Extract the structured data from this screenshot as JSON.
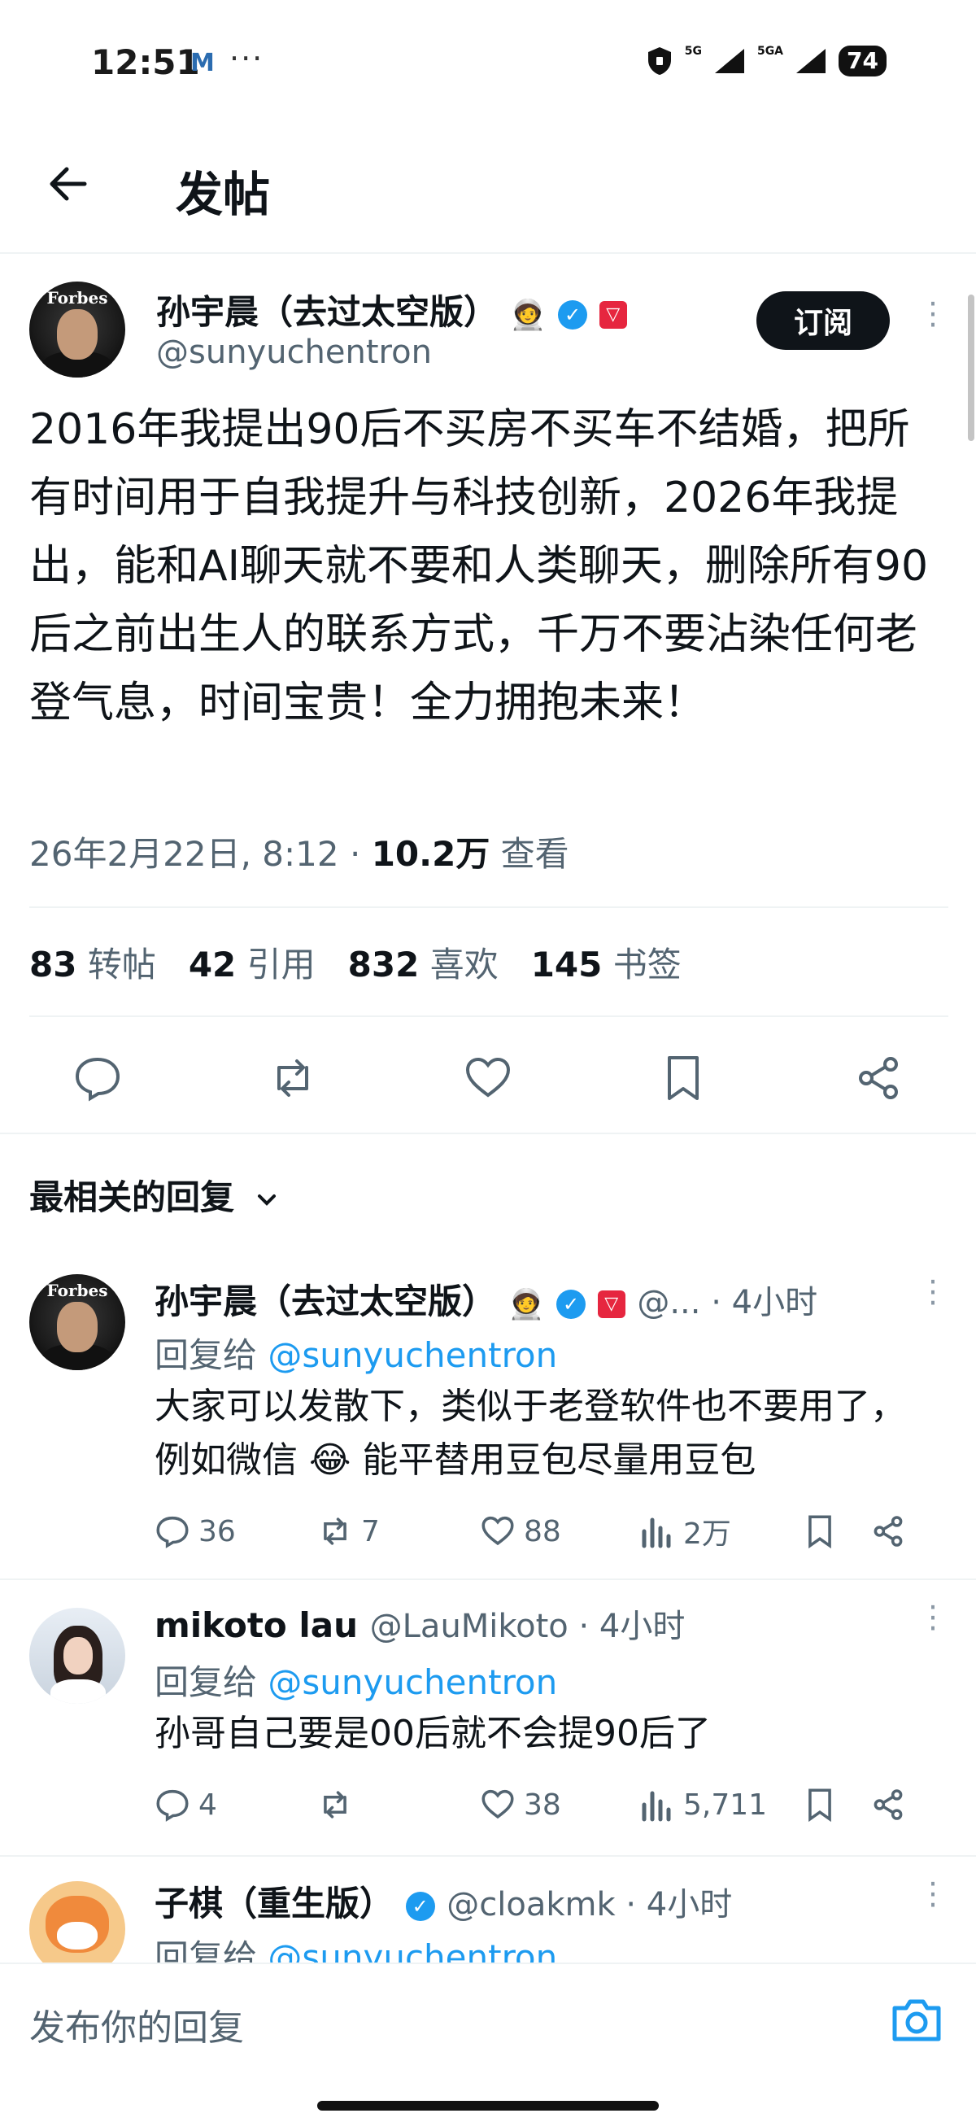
{
  "status_bar": {
    "time": "12:51",
    "mail_icon_letter": "M",
    "dots": "···",
    "network1": "5G",
    "network2": "5GA",
    "battery": "74"
  },
  "header": {
    "title": "发帖",
    "back_icon": "arrow-left-icon"
  },
  "tweet": {
    "author_name": "孙宇晨（去过太空版）",
    "author_handle": "@sunyuchentron",
    "avatar_text": "Forbes",
    "subscribe_label": "订阅",
    "text": "2016年我提出90后不买房不买车不结婚，把所有时间用于自我提升与科技创新，2026年我提出，能和AI聊天就不要和人类聊天，删除所有90后之前出生人的联系方式，千万不要沾染任何老登气息，时间宝贵！全力拥抱未来！",
    "timestamp": "26年2月22日, 8:12 · ",
    "views_count": "10.2万",
    "views_label": " 查看",
    "stats": [
      {
        "count": "83",
        "label": "转帖"
      },
      {
        "count": "42",
        "label": "引用"
      },
      {
        "count": "832",
        "label": "喜欢"
      },
      {
        "count": "145",
        "label": "书签"
      }
    ]
  },
  "replies_section": {
    "sort_label": "最相关的回复"
  },
  "replies": [
    {
      "name": "孙宇晨（去过太空版）",
      "handle_time": "@... · 4小时",
      "reply_to_prefix": "回复给 ",
      "reply_to": "@sunyuchentron",
      "body": "大家可以发散下，类似于老登软件也不要用了，例如微信 😂 能平替用豆包尽量用豆包",
      "comments": "36",
      "retweets": "7",
      "likes": "88",
      "views": "2万"
    },
    {
      "name": "mikoto lau",
      "handle_time": "@LauMikoto · 4小时",
      "reply_to_prefix": "回复给 ",
      "reply_to": "@sunyuchentron",
      "body": "孙哥自己要是00后就不会提90后了",
      "comments": "4",
      "retweets": "",
      "likes": "38",
      "views": "5,711"
    },
    {
      "name": "子棋（重生版）",
      "handle_time": "@cloakmk · 4小时",
      "reply_to_prefix": "回复给 ",
      "reply_to": "@sunyuchentron"
    }
  ],
  "composer": {
    "placeholder": "发布你的回复"
  },
  "colors": {
    "accent": "#1d9bf0",
    "text": "#0f1419",
    "muted": "#536471",
    "tron_red": "#e6263f"
  }
}
